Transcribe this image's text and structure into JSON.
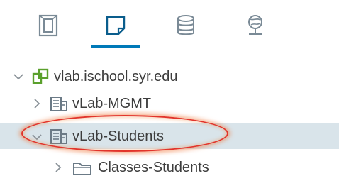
{
  "tabs": [
    {
      "name": "hosts-and-clusters",
      "icon": "hosts-clusters-icon",
      "active": false
    },
    {
      "name": "vms-and-templates",
      "icon": "vms-templates-icon",
      "active": true
    },
    {
      "name": "storage",
      "icon": "database-icon",
      "active": false
    },
    {
      "name": "networking",
      "icon": "network-globe-icon",
      "active": false
    }
  ],
  "tree": {
    "vcenter": {
      "label": "vlab.ischool.syr.edu",
      "icon": "vcenter-icon",
      "expanded": true
    },
    "items": [
      {
        "label": "vLab-MGMT",
        "icon": "datacenter-icon",
        "expanded": false,
        "selected": false
      },
      {
        "label": "vLab-Students",
        "icon": "datacenter-icon",
        "expanded": true,
        "selected": true
      },
      {
        "label": "Classes-Students",
        "icon": "folder-icon",
        "expanded": false,
        "selected": false
      }
    ]
  },
  "colors": {
    "accent": "#0079b8",
    "selection": "#d9e4ea",
    "highlight_ring": "#e2342a",
    "vcenter_green": "#5aa02c",
    "icon_gray": "#6b7a86"
  }
}
